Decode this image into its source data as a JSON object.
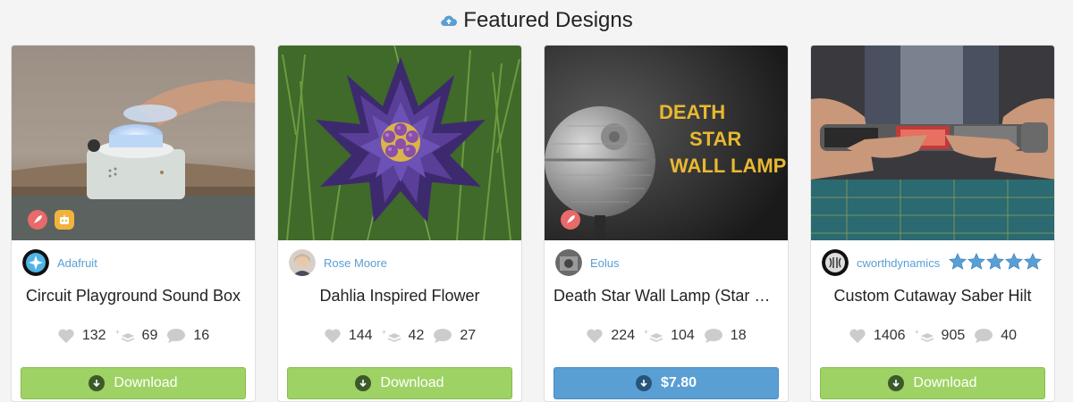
{
  "header": {
    "title": "Featured Designs",
    "icon": "cloud-upload-icon",
    "icon_color": "#5a9fd4"
  },
  "cards": [
    {
      "creator": "Adafruit",
      "title": "Circuit Playground Sound Box",
      "likes": "132",
      "remixes": "69",
      "comments": "16",
      "button": "Download",
      "button_type": "download",
      "badges": [
        "rocket-icon",
        "robot-icon"
      ]
    },
    {
      "creator": "Rose Moore",
      "title": "Dahlia Inspired Flower",
      "likes": "144",
      "remixes": "42",
      "comments": "27",
      "button": "Download",
      "button_type": "download",
      "badges": []
    },
    {
      "creator": "Eolus",
      "title": "Death Star Wall Lamp (Star Wars)",
      "likes": "224",
      "remixes": "104",
      "comments": "18",
      "button": "$7.80",
      "button_type": "purchase",
      "badges": [
        "rocket-icon"
      ],
      "image_text": [
        "DEATH",
        "STAR",
        "WALL LAMP"
      ]
    },
    {
      "creator": "cworthdynamics",
      "title": "Custom Cutaway Saber Hilt",
      "likes": "1406",
      "remixes": "905",
      "comments": "40",
      "button": "Download",
      "button_type": "download",
      "badges": [],
      "rating": 5
    }
  ],
  "colors": {
    "download": "#9ed265",
    "purchase": "#5a9fd4",
    "creator_link": "#5a9fd4",
    "star": "#5a9fd4"
  }
}
